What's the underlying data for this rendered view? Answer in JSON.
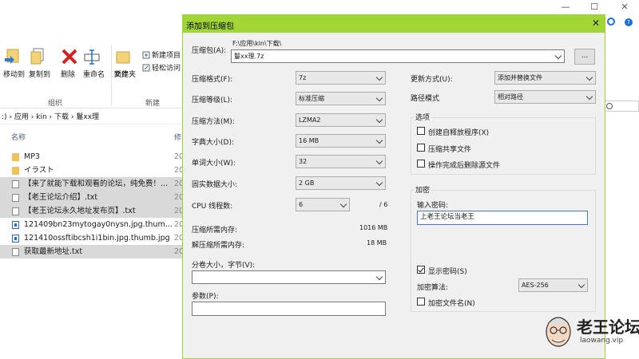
{
  "explorer": {
    "ribbon": {
      "move_to": "移动到",
      "copy_to": "复制到",
      "delete": "删除",
      "rename": "重命名",
      "new_folder": "新建\n文件夹",
      "new_folder_line1": "新建",
      "new_folder_line2": "文件夹",
      "new_item": "新建项目",
      "easy_access": "轻松访问",
      "group_organize": "组织",
      "group_new": "新建"
    },
    "breadcrumb": ":)  ›  应用  ›  kin  ›  下载  ›  鬘xx理",
    "breadcrumb_parts": [
      ":)",
      "应用",
      "kin",
      "下载",
      "鬘xx理"
    ],
    "column_name": "名称",
    "column_date_partial": "修",
    "files": [
      {
        "name": "MP3",
        "icon": "folder-icon",
        "date": "20",
        "selected": false
      },
      {
        "name": "イラスト",
        "icon": "folder-icon",
        "date": "20",
        "selected": false
      },
      {
        "name": "【来了就能下载和观看的论坛，纯免费！...",
        "icon": "txt-icon",
        "date": "20",
        "selected": true
      },
      {
        "name": "【老王论坛介绍】.txt",
        "icon": "txt-icon",
        "date": "20",
        "selected": true
      },
      {
        "name": "【老王论坛永久地址发布页】.txt",
        "icon": "txt-icon",
        "date": "20",
        "selected": true
      },
      {
        "name": "121409bn23mytogay0nysn.jpg.thum...",
        "icon": "image-icon",
        "date": "20",
        "selected": false
      },
      {
        "name": "121410ossftibcsh1i1bin.jpg.thumb.jpg",
        "icon": "image-icon",
        "date": "20",
        "selected": false
      },
      {
        "name": "获取最新地址.txt",
        "icon": "txt-icon",
        "date": "20",
        "selected": true
      }
    ]
  },
  "dialog": {
    "title": "添加到压缩包",
    "archive_label": "压缩包(A):",
    "archive_path": "F:\\应用\\kin\\下载\\",
    "archive_name": "鬘xx理.7z",
    "browse_label": "...",
    "format_label": "压缩格式(F):",
    "format_value": "7z",
    "level_label": "压缩等级(L):",
    "level_value": "标准压缩",
    "method_label": "压缩方法(M):",
    "method_value": "LZMA2",
    "dict_label": "字典大小(D):",
    "dict_value": "16 MB",
    "word_label": "单词大小(W):",
    "word_value": "32",
    "solid_label": "固实数据大小:",
    "solid_value": "2 GB",
    "cpu_label": "CPU 线程数:",
    "cpu_value": "6",
    "cpu_max": "/ 6",
    "mem_compress_label": "压缩所需内存:",
    "mem_compress_value": "1016 MB",
    "mem_decompress_label": "解压缩所需内存:",
    "mem_decompress_value": "18 MB",
    "split_label": "分卷大小，字节(V):",
    "split_value": "",
    "params_label": "参数(P):",
    "params_value": "",
    "update_label": "更新方式(U):",
    "update_value": "添加并替换文件",
    "path_label": "路径模式",
    "path_value": "相对路径",
    "options_title": "选项",
    "opt_sfx": "创建自释放程序(X)",
    "opt_shared": "压缩共享文件",
    "opt_delete": "操作完成后删除源文件",
    "encrypt_title": "加密",
    "password_label": "输入密码:",
    "password_value": "上老王论坛当老王",
    "show_password_label": "显示密码(S)",
    "method_enc_label": "加密算法:",
    "method_enc_value": "AES-256",
    "encrypt_names_label": "加密文件名(N)",
    "checks": {
      "sfx": false,
      "shared": false,
      "delete": false,
      "show_password": true,
      "encrypt_names": false
    }
  },
  "watermark": {
    "text": "老王论坛",
    "sub": "laowang.vip"
  },
  "colors": {
    "title_bar": "#a0d736",
    "selection": "#d9d9d9",
    "folder": "#f0c05a"
  }
}
